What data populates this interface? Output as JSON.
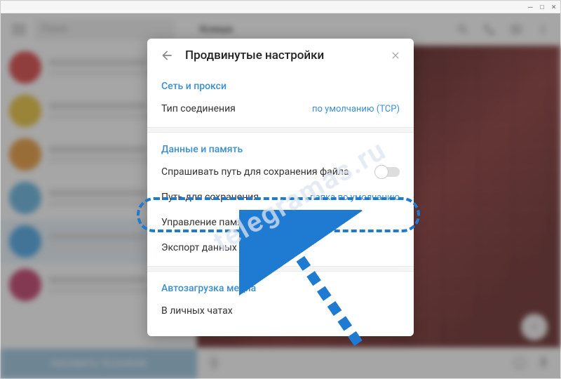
{
  "window": {
    "min": "—",
    "max": "☐",
    "close": "✕"
  },
  "bg": {
    "search_placeholder": "Поиск",
    "chat_title": "Ксюша",
    "update_button": "ОБНОВИТЬ TELEGRAM",
    "avatars": [
      "#d94242",
      "#e8c33a",
      "#e89a3a",
      "#63b4e0",
      "#4aa5e6",
      "#c33b6a"
    ]
  },
  "modal": {
    "title": "Продвинутые настройки",
    "sections": {
      "network": {
        "header": "Сеть и прокси",
        "connection_type_label": "Тип соединения",
        "connection_type_value": "по умолчанию (TCP)"
      },
      "data": {
        "header": "Данные и память",
        "ask_path_label": "Спрашивать путь для сохранения файла",
        "save_path_label": "Путь для сохранения",
        "save_path_value": "папка по умолчанию",
        "memory_mgmt_label": "Управление памятью устройства",
        "export_label": "Экспорт данных из Telegram"
      },
      "autoload": {
        "header": "Автозагрузка медиа",
        "private_label": "В личных чатах"
      }
    }
  },
  "watermark": "telegramas.ru"
}
